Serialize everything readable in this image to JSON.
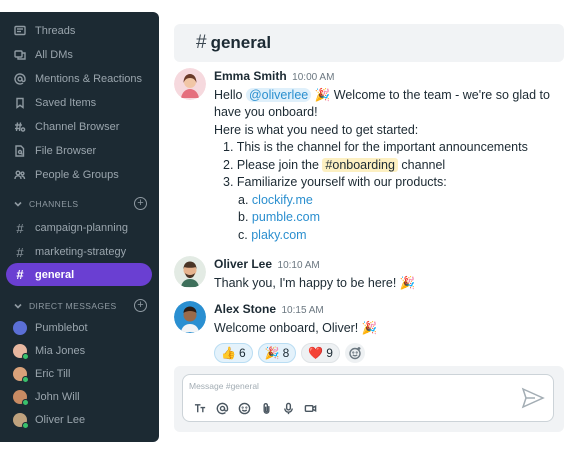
{
  "sidebar": {
    "nav": [
      {
        "label": "Threads",
        "icon": "threads-icon"
      },
      {
        "label": "All DMs",
        "icon": "all-dms-icon"
      },
      {
        "label": "Mentions & Reactions",
        "icon": "at-icon"
      },
      {
        "label": "Saved Items",
        "icon": "bookmark-icon"
      },
      {
        "label": "Channel Browser",
        "icon": "channel-browser-icon"
      },
      {
        "label": "File Browser",
        "icon": "file-search-icon"
      },
      {
        "label": "People & Groups",
        "icon": "people-icon"
      }
    ],
    "channels_header": "CHANNELS",
    "channels": [
      {
        "label": "campaign-planning"
      },
      {
        "label": "marketing-strategy"
      },
      {
        "label": "general",
        "active": true
      }
    ],
    "dms_header": "DIRECT MESSAGES",
    "dms": [
      {
        "label": "Pumblebot"
      },
      {
        "label": "Mia Jones"
      },
      {
        "label": "Eric Till"
      },
      {
        "label": "John Will"
      },
      {
        "label": "Oliver Lee"
      }
    ]
  },
  "channel": {
    "hash": "#",
    "title": "general"
  },
  "messages": [
    {
      "name": "Emma Smith",
      "time": "10:00 AM",
      "hello": "Hello",
      "mention": "@oliverlee",
      "party": "🎉",
      "welcome": "Welcome to the team - we're so glad to have you onboard!",
      "intro": "Here is what you need to get started:",
      "items": {
        "one_num": "1.",
        "one": "This is the channel for the important announcements",
        "two_num": "2.",
        "two_a": "Please join the",
        "two_tag": "#onboarding",
        "two_b": "channel",
        "three_num": "3.",
        "three": "Familiarize yourself with our products:"
      },
      "links": [
        {
          "letter": "a.",
          "text": "clockify.me"
        },
        {
          "letter": "b.",
          "text": "pumble.com"
        },
        {
          "letter": "c.",
          "text": "plaky.com"
        }
      ]
    },
    {
      "name": "Oliver Lee",
      "time": "10:10 AM",
      "text": "Thank you, I'm happy to be here!",
      "party": "🎉"
    },
    {
      "name": "Alex Stone",
      "time": "10:15 AM",
      "text": "Welcome onboard, Oliver!",
      "party": "🎉"
    }
  ],
  "reactions": [
    {
      "emoji": "👍",
      "count": "6"
    },
    {
      "emoji": "🎉",
      "count": "8"
    },
    {
      "emoji": "❤️",
      "count": "9"
    }
  ],
  "composer": {
    "placeholder": "Message #general"
  },
  "colors": {
    "sidebar": "#1c2a33",
    "active": "#6a3fd2",
    "link": "#2b8fcf"
  }
}
